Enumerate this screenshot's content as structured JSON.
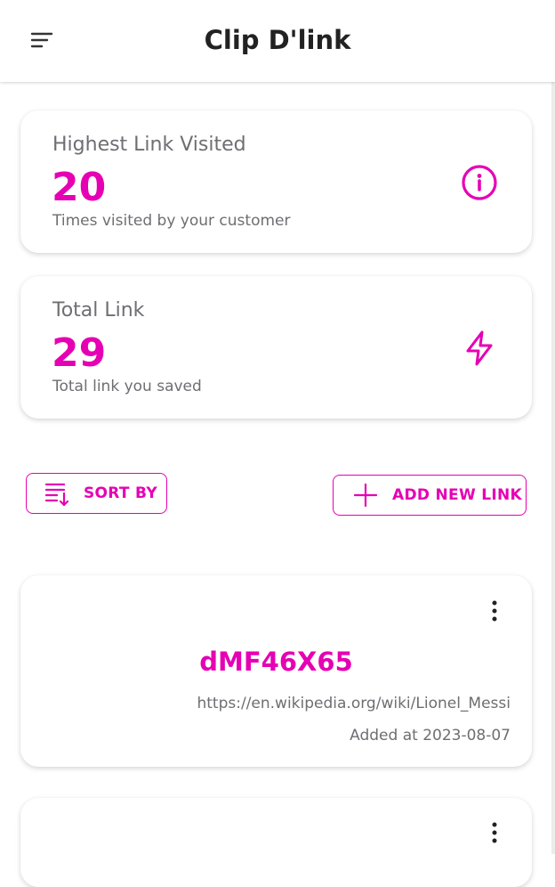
{
  "app": {
    "title": "Clip D'link",
    "accent_color": "#e600b4",
    "menu_icon": "menu-sort-icon"
  },
  "stats": [
    {
      "label": "Highest Link Visited",
      "value": "20",
      "description": "Times visited by your customer",
      "icon": "info-icon"
    },
    {
      "label": "Total Link",
      "value": "29",
      "description": "Total link you saved",
      "icon": "lightning-icon"
    }
  ],
  "actions": {
    "sort_label": "SORT BY",
    "sort_icon": "sort-list-icon",
    "add_label": "ADD NEW LINK",
    "add_icon": "plus-icon"
  },
  "links": [
    {
      "code": "dMF46X65",
      "url": "https://en.wikipedia.org/wiki/Lionel_Messi",
      "added": "Added at 2023-08-07",
      "menu_icon": "more-vertical-icon"
    },
    {
      "menu_icon": "more-vertical-icon"
    }
  ]
}
